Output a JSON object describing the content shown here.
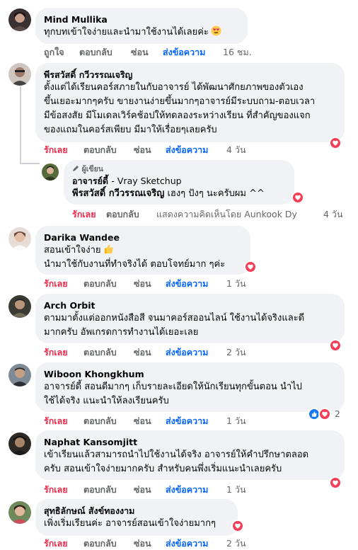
{
  "actions": {
    "like": "ถูกใจ",
    "liked": "รักเลย",
    "reply": "ตอบกลับ",
    "hide": "ซ่อน",
    "message": "ส่งข้อความ"
  },
  "comments": [
    {
      "author": "Mind Mullika",
      "lines": [
        "ทุกบทเข้าใจง่ายและนำมาใช้งานได้เลยค่ะ"
      ],
      "emoji": "heart-eyes",
      "reacted": false,
      "time": "16 ชม."
    },
    {
      "author": "พีรสวัสดิ์ กวีวรรณเจริญ",
      "lines": [
        "ตั้งแต่ได้เรียนคอร์สภายในกับอาจารย์ ได้พัฒนาศักยภาพของตัวเอง",
        "ขึ้นเยอะมากๆครับ ขายงานง่ายขึ้นมากๆอาจารย์มีระบบถาม-ตอบเวลา",
        "มีข้อสงสัย มีโมเดลเวิร์คช้อปให้ทดลองระหว่างเรียน ที่สำคัญของแจก",
        "ของแถมในคอร์สเพียบ มีมาให้เรื่อยๆเลยครับ"
      ],
      "reacted": true,
      "time": "4 วัน"
    },
    {
      "author": "Darika Wandee",
      "lines": [
        "สอนเข้าใจง่าย",
        "นำมาใช้กับงานที่ทำจริงได้ ตอบโจทย์มาก ๆค่ะ"
      ],
      "emoji": "thumbs-up",
      "reacted": true,
      "time": "1 วัน"
    },
    {
      "author": "Arch Orbit",
      "lines": [
        "ตามมาตั้งแต่ออกหนังสือสี จนมาคอร์สออนไลน์ ใช้งานได้จริงและดี",
        "มากครับ อัพเกรดการทำงานได้เยอะเลย"
      ],
      "reacted": true,
      "time": "2 วัน"
    },
    {
      "author": "Wiboon Khongkhum",
      "lines": [
        "อาจารย์ดี้ สอนดีมากๆ เก็บรายละเอียดให้นักเรียนทุกขั้นตอน นำไป",
        "ใช้ได้จริง แนะนำให้ลงเรียนครับ"
      ],
      "reacted": true,
      "reaction_count": "2",
      "time": "1 วัน"
    },
    {
      "author": "Naphat Kansomjitt",
      "lines": [
        "เข้าเรียนแล้วสามารถนำไปใช้งานได้จริง อาจารย์ให้คำปรึกษาตลอด",
        "ครับ สอนเข้าใจง่ายมากครับ สำหรับคนพึ่งเริ่มแนะนำเลยครับ"
      ],
      "reacted": true,
      "time": "1 วัน"
    },
    {
      "author": "สุทธิลักษณ์ สังข์ทองงาม",
      "lines": [
        "เพิ่งเริ่มเรียนค่ะ อาจารย์สอนเข้าใจง่ายมากๆ"
      ],
      "reacted": true,
      "time": "2 วัน"
    }
  ],
  "reply": {
    "badge": "ผู้เขียน",
    "author": "อาจารย์ดี้",
    "page": "- Vray Sketchup",
    "tag": "พีรสวัสดิ์ กวีวรรณเจริญ",
    "text": "เฮงๆ ปังๆ นะครับผม ^^",
    "seen_by": "แสดงความคิดเห็นโดย Aunkook Dy",
    "time": "4 วัน"
  },
  "colors": {
    "bubble": "#f0f2f5",
    "liked": "#f02849",
    "message": "#0866ff",
    "muted": "#65676b"
  }
}
